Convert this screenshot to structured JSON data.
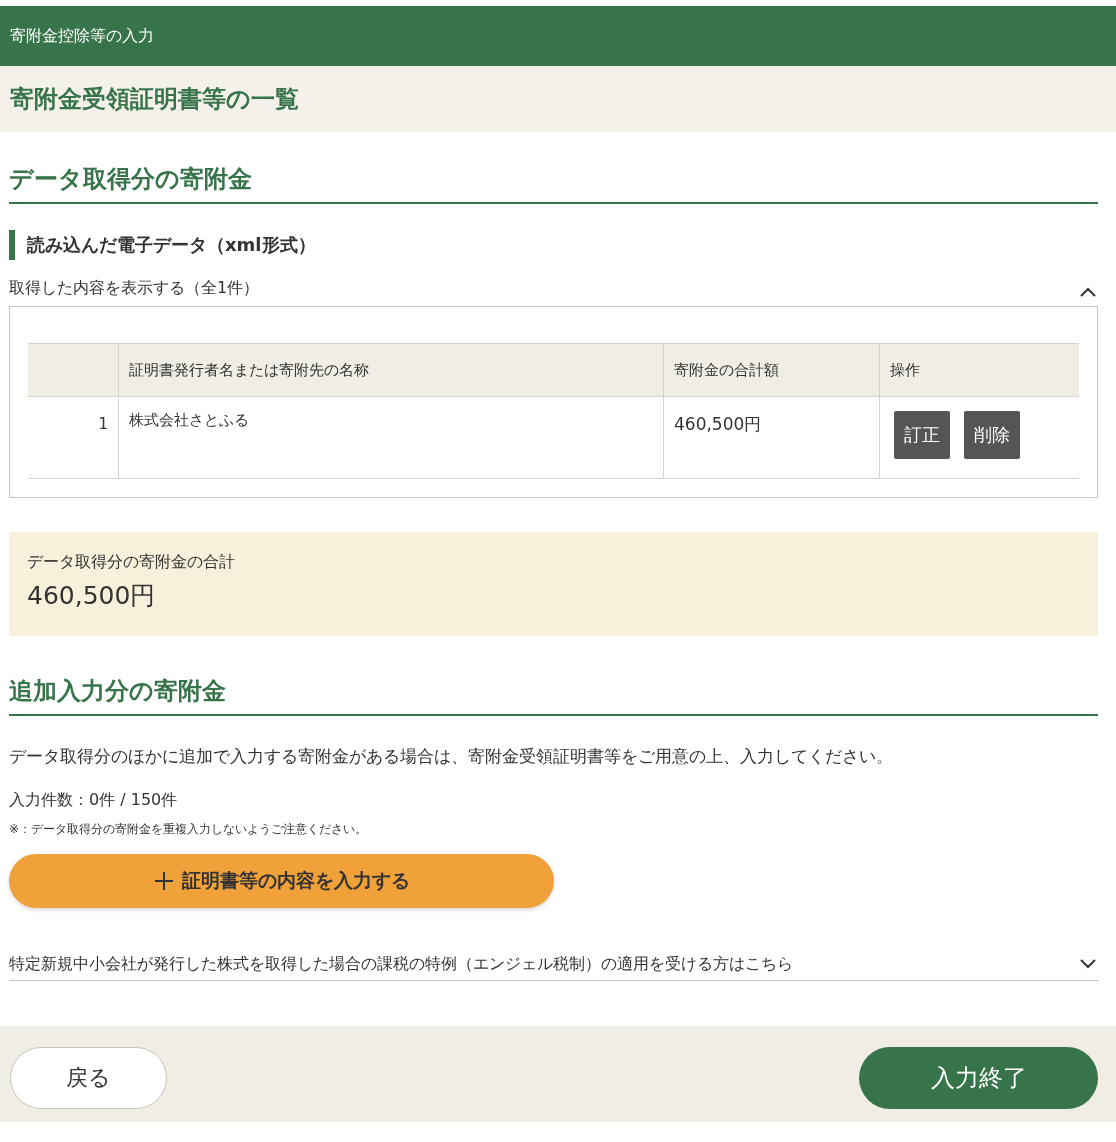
{
  "header": {
    "title": "寄附金控除等の入力"
  },
  "page_title": "寄附金受領証明書等の一覧",
  "data_section": {
    "heading": "データ取得分の寄附金",
    "subheading": "読み込んだ電子データ（xml形式）",
    "disclosure": {
      "label": "取得した内容を表示する（全1件）",
      "expanded": true
    },
    "table": {
      "columns": [
        "証明書発行者名または寄附先の名称",
        "寄附金の合計額",
        "操作"
      ],
      "rows": [
        {
          "number": "1",
          "name": "株式会社さとふる",
          "amount": "460,500円",
          "actions": [
            "訂正",
            "削除"
          ]
        }
      ]
    },
    "total": {
      "label": "データ取得分の寄附金の合計",
      "amount": "460,500円"
    }
  },
  "additional_section": {
    "heading": "追加入力分の寄附金",
    "description": "データ取得分のほかに追加で入力する寄附金がある場合は、寄附金受領証明書等をご用意の上、入力してください。",
    "count": "入力件数：0件 / 150件",
    "note": "※：データ取得分の寄附金を重複入力しないようご注意ください。",
    "add_button": "証明書等の内容を入力する",
    "disclosure": {
      "label": "特定新規中小会社が発行した株式を取得した場合の課税の特例（エンジェル税制）の適用を受ける方はこちら",
      "expanded": false
    }
  },
  "footer": {
    "back_button": "戻る",
    "finish_button": "入力終了"
  }
}
